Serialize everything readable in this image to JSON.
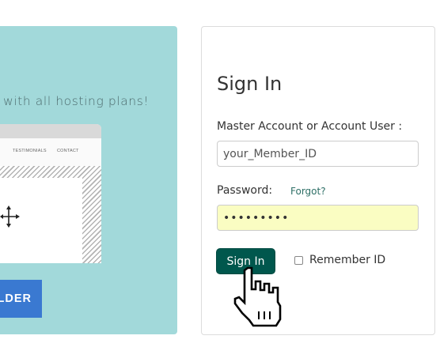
{
  "promo": {
    "tagline": "with all hosting plans!",
    "nav_items": [
      "TESTIMONIALS",
      "CONTACT"
    ],
    "builder_label": "LDER",
    "move_icon": "move-arrows-icon",
    "colors": {
      "panel": "#a2d9da",
      "builder_button": "#3a79d1"
    }
  },
  "signin": {
    "title": "Sign In",
    "account_label": "Master Account or Account User :",
    "account_value": "your_Member_ID",
    "password_label": "Password:",
    "forgot_link": "Forgot?",
    "password_value": "•••••••••",
    "button_label": "Sign In",
    "remember_label": "Remember ID",
    "remember_checked": false,
    "colors": {
      "button": "#00574d",
      "password_field": "#fafdc2",
      "link": "#2e6f66"
    }
  },
  "cursor": {
    "icon": "pointer-hand-icon"
  }
}
